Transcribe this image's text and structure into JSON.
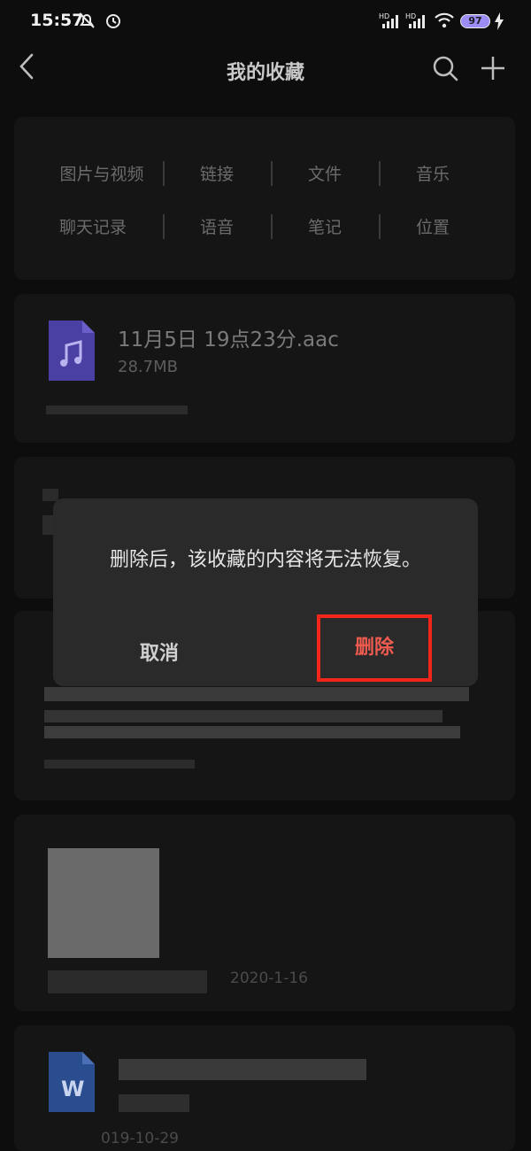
{
  "status_bar": {
    "time": "15:57",
    "battery": "97"
  },
  "header": {
    "title": "我的收藏"
  },
  "categories": {
    "row1": [
      "图片与视频",
      "链接",
      "文件",
      "音乐"
    ],
    "row2": [
      "聊天记录",
      "语音",
      "笔记",
      "位置"
    ]
  },
  "file_item": {
    "name": "11月5日 19点23分.aac",
    "size": "28.7MB"
  },
  "image_item": {
    "date": "2020-1-16"
  },
  "doc_item": {
    "date": "019-10-29",
    "icon_letter": "W"
  },
  "dialog": {
    "message": "删除后，该收藏的内容将无法恢复。",
    "cancel_label": "取消",
    "delete_label": "删除"
  },
  "colors": {
    "accent_red": "#f0261b",
    "audio_icon": "#4a3fa3",
    "word_icon": "#2a4d8f"
  }
}
